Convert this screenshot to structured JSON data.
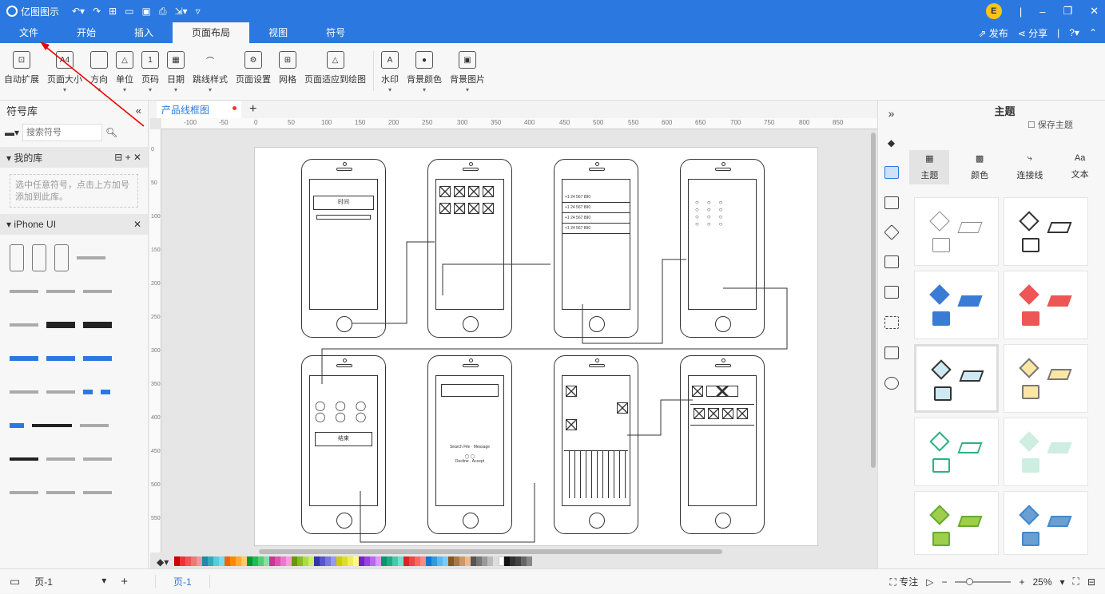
{
  "app": {
    "title": "亿图图示"
  },
  "user": {
    "initial": "E"
  },
  "tabs": [
    "文件",
    "开始",
    "插入",
    "页面布局",
    "视图",
    "符号"
  ],
  "tab_actions": {
    "publish": "发布",
    "share": "分享"
  },
  "ribbon": [
    "自动扩展",
    "页面大小",
    "方向",
    "单位",
    "页码",
    "日期",
    "跳线样式",
    "页面设置",
    "网格",
    "页面适应到绘图",
    "水印",
    "背景颜色",
    "背景图片"
  ],
  "left": {
    "title": "符号库",
    "search_placeholder": "搜索符号",
    "my_lib": "我的库",
    "hint": "选中任意符号，点击上方加号添加到此库。",
    "iphone_lib": "iPhone UI"
  },
  "doc": {
    "tab": "产品线框图"
  },
  "ruler": [
    "-100",
    "-50",
    "0",
    "50",
    "100",
    "150",
    "200",
    "250",
    "300",
    "350",
    "400",
    "450",
    "500",
    "550",
    "600",
    "650",
    "700",
    "750",
    "800",
    "850"
  ],
  "vruler": [
    "0",
    "50",
    "100",
    "150",
    "200",
    "250",
    "300",
    "350",
    "400",
    "450",
    "500",
    "550"
  ],
  "right": {
    "title": "主题",
    "save_theme": "保存主题",
    "tabs": [
      "主题",
      "颜色",
      "连接线",
      "文本"
    ]
  },
  "status": {
    "page_select": "页-1",
    "page_tab": "页-1",
    "focus": "专注",
    "zoom": "25%"
  },
  "phones": {
    "btn_log": "时间",
    "btn_end": "结束",
    "row_text": "+1 24 567 890",
    "mid_labels": [
      "Search File",
      "Message",
      "Decline",
      "Accept"
    ]
  }
}
